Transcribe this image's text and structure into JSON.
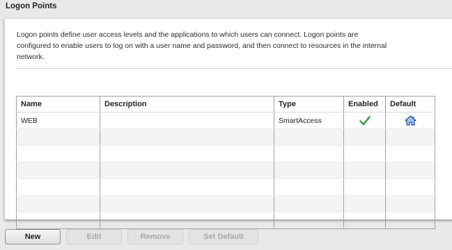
{
  "header": {
    "title": "Logon Points"
  },
  "description": "Logon points define user access levels and the applications to which users can connect. Logon points are configured to enable users to log on with a user name and password, and then connect to resources in the internal network.",
  "table": {
    "columns": [
      "Name",
      "Description",
      "Type",
      "Enabled",
      "Default"
    ],
    "rows": [
      {
        "name": "WEB",
        "description": "",
        "type": "SmartAccess",
        "enabled_icon": "check-icon",
        "default_icon": "home-icon"
      }
    ]
  },
  "buttons": {
    "new": "New",
    "edit": "Edit",
    "remove": "Remove",
    "set_default": "Set Default"
  },
  "colors": {
    "check": "#3aa43a",
    "home": "#2f6fcf"
  }
}
